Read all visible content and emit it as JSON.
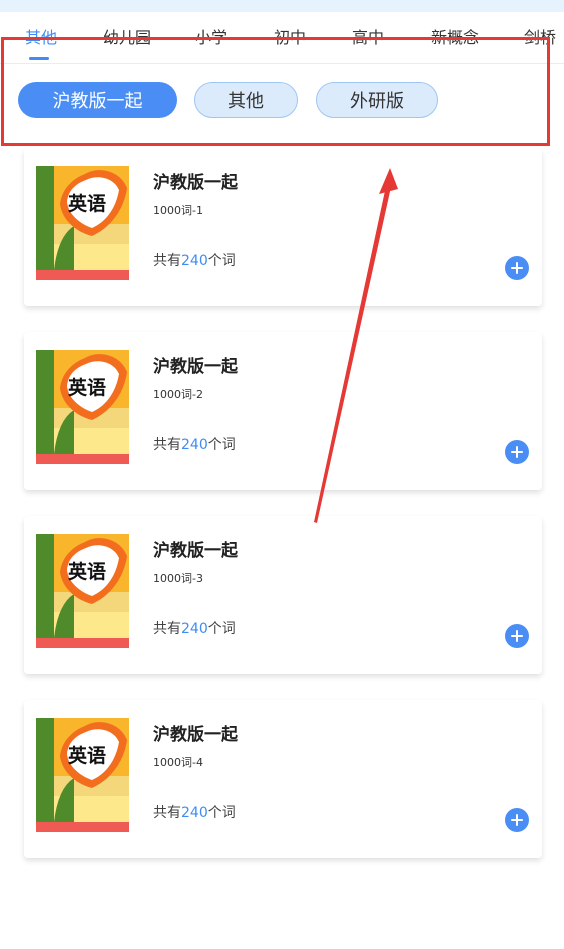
{
  "tabs": [
    {
      "label": "其他",
      "active": true
    },
    {
      "label": "幼儿园"
    },
    {
      "label": "小学"
    },
    {
      "label": "初中"
    },
    {
      "label": "高中"
    },
    {
      "label": "新概念"
    },
    {
      "label": "剑桥"
    }
  ],
  "filters": [
    {
      "label": "沪教版一起",
      "selected": true
    },
    {
      "label": "其他"
    },
    {
      "label": "外研版"
    }
  ],
  "books": [
    {
      "title": "沪教版一起",
      "subtitle": "1000词-1",
      "count_prefix": "共有",
      "count": "240",
      "count_suffix": "个词",
      "cover_text": "英语"
    },
    {
      "title": "沪教版一起",
      "subtitle": "1000词-2",
      "count_prefix": "共有",
      "count": "240",
      "count_suffix": "个词",
      "cover_text": "英语"
    },
    {
      "title": "沪教版一起",
      "subtitle": "1000词-3",
      "count_prefix": "共有",
      "count": "240",
      "count_suffix": "个词",
      "cover_text": "英语"
    },
    {
      "title": "沪教版一起",
      "subtitle": "1000词-4",
      "count_prefix": "共有",
      "count": "240",
      "count_suffix": "个词",
      "cover_text": "英语"
    }
  ],
  "colors": {
    "accent": "#3f8cf5",
    "annotation": "#e53935"
  },
  "icons": {
    "add": "plus-circle-icon"
  }
}
